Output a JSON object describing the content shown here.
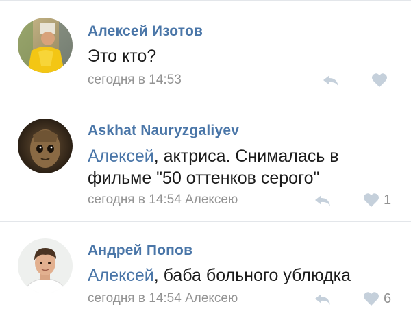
{
  "comments": [
    {
      "author": "Алексей Изотов",
      "text": "Это кто?",
      "timestamp": "сегодня в 14:53",
      "reply_to": "",
      "likes": "",
      "avatar_icon": "person-yellow-shirt-avatar"
    },
    {
      "author": "Askhat Nauryzgaliyev",
      "mention": "Алексей",
      "text_line1": ", актриса. Снималась в",
      "text_line2": "фильме \"50 оттенков серого\"",
      "timestamp": "сегодня в 14:54",
      "reply_to": "Алексею",
      "likes": "1",
      "avatar_icon": "groot-avatar"
    },
    {
      "author": "Андрей Попов",
      "mention": "Алексей",
      "text": ", баба больного ублюдка",
      "timestamp": "сегодня в 14:54",
      "reply_to": "Алексею",
      "likes": "6",
      "avatar_icon": "man-portrait-avatar"
    }
  ],
  "colors": {
    "link": "#4a76a8",
    "text": "#1c1c1c",
    "meta": "#939393",
    "icon": "#c5d0db",
    "divider": "#e3e6ea"
  }
}
